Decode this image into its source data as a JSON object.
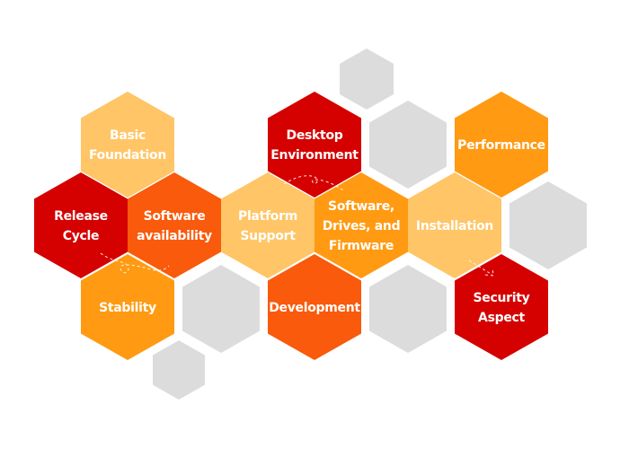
{
  "colors": {
    "red": "#D50000",
    "deep_orange": "#F95A0B",
    "orange": "#FF9A12",
    "light_orange": "#FFC566",
    "gray": "#DCDCDC"
  },
  "hexagons": [
    {
      "id": "basic-foundation",
      "lines": [
        "Basic",
        "Foundation"
      ],
      "color": "light_orange"
    },
    {
      "id": "desktop-environment",
      "lines": [
        "Desktop",
        "Environment"
      ],
      "color": "red"
    },
    {
      "id": "performance",
      "lines": [
        "Performance"
      ],
      "color": "orange"
    },
    {
      "id": "release-cycle",
      "lines": [
        "Release",
        "Cycle"
      ],
      "color": "red"
    },
    {
      "id": "software-availability",
      "lines": [
        "Software",
        "availability"
      ],
      "color": "deep_orange"
    },
    {
      "id": "platform-support",
      "lines": [
        "Platform",
        "Support"
      ],
      "color": "light_orange"
    },
    {
      "id": "software-drives-firmware",
      "lines": [
        "Software,",
        "Drives, and",
        "Firmware"
      ],
      "color": "orange"
    },
    {
      "id": "installation",
      "lines": [
        "Installation"
      ],
      "color": "light_orange"
    },
    {
      "id": "stability",
      "lines": [
        "Stability"
      ],
      "color": "orange"
    },
    {
      "id": "development",
      "lines": [
        "Development"
      ],
      "color": "deep_orange"
    },
    {
      "id": "security-aspect",
      "lines": [
        "Security",
        "Aspect"
      ],
      "color": "red"
    }
  ]
}
